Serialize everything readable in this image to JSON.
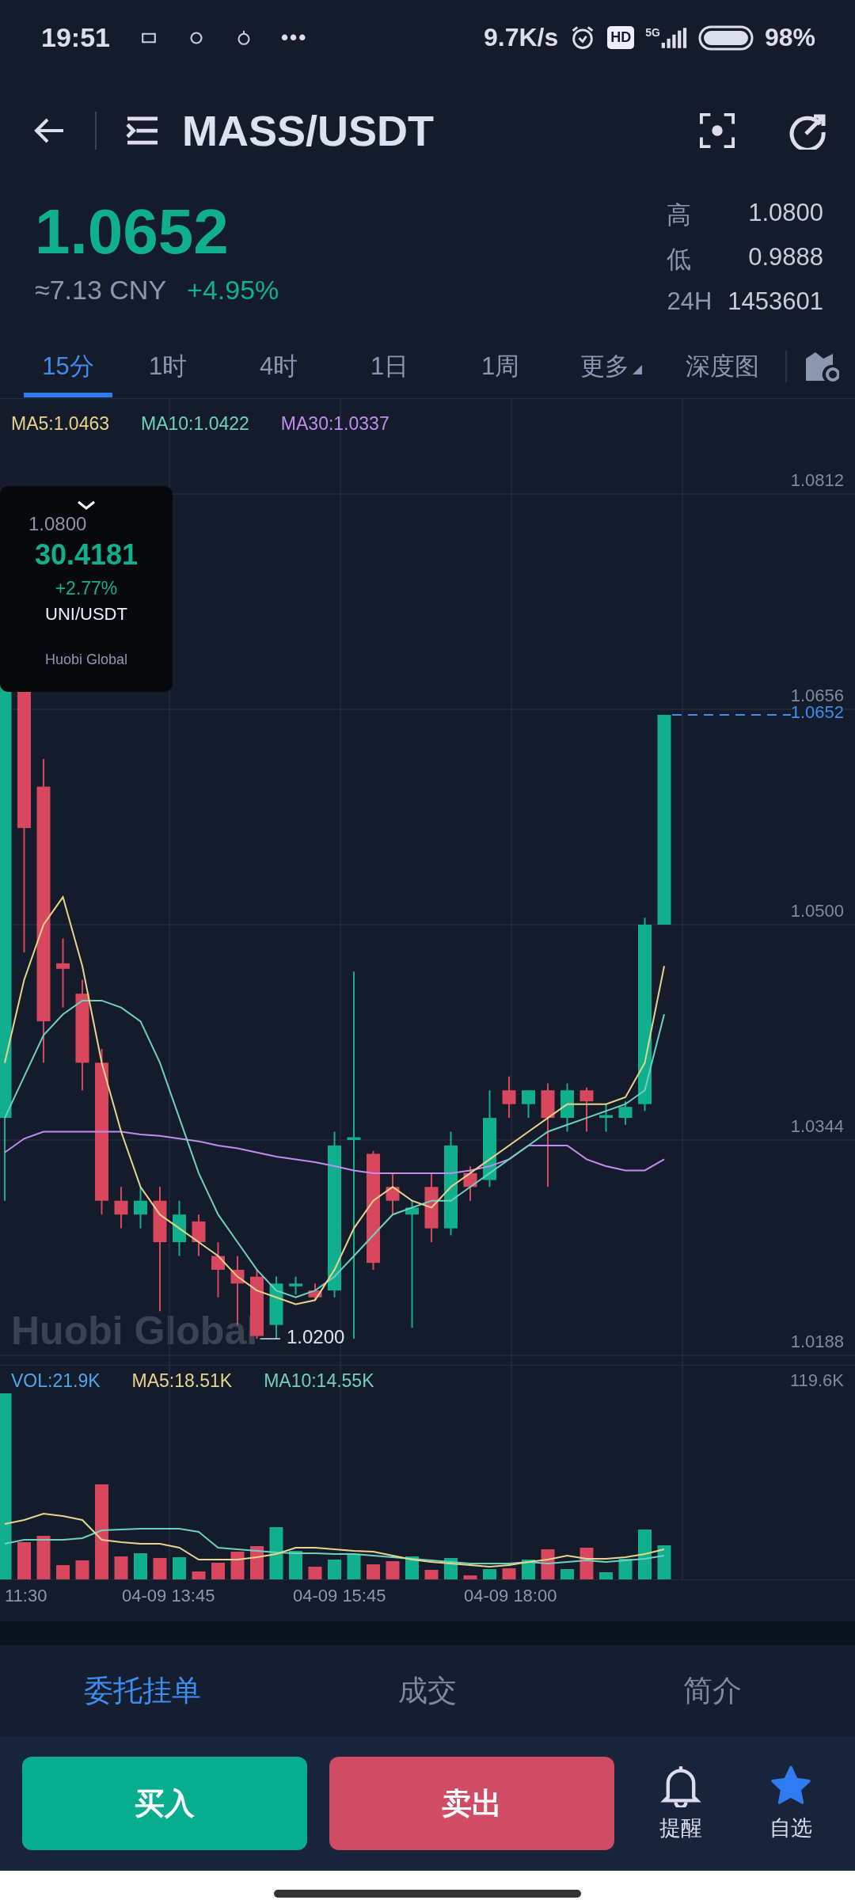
{
  "status_bar": {
    "time": "19:51",
    "more": "•••",
    "speed": "9.7K/s",
    "hd": "HD",
    "network": "5G",
    "battery": "98%"
  },
  "header": {
    "pair": "MASS/USDT"
  },
  "price": {
    "last": "1.0652",
    "cny": "≈7.13 CNY",
    "change": "+4.95%",
    "stats": [
      {
        "label": "高",
        "value": "1.0800"
      },
      {
        "label": "低",
        "value": "0.9888"
      },
      {
        "label": "24H",
        "value": "1453601"
      }
    ]
  },
  "intervals": [
    {
      "label": "15分",
      "selected": true,
      "kind": "plain"
    },
    {
      "label": "1时",
      "selected": false,
      "kind": "plain"
    },
    {
      "label": "4时",
      "selected": false,
      "kind": "plain"
    },
    {
      "label": "1日",
      "selected": false,
      "kind": "plain"
    },
    {
      "label": "1周",
      "selected": false,
      "kind": "plain"
    },
    {
      "label": "更多",
      "selected": false,
      "kind": "dropdown"
    },
    {
      "label": "深度图",
      "selected": false,
      "kind": "plain"
    }
  ],
  "chart": {
    "ma_legend": [
      {
        "text": "MA5:1.0463",
        "color": "#e8d48a"
      },
      {
        "text": "MA10:1.0422",
        "color": "#6fd0c0"
      },
      {
        "text": "MA30:1.0337",
        "color": "#c38cf0"
      }
    ],
    "y_labels": [
      "1.0812",
      "1.0656",
      "1.0500",
      "1.0344",
      "1.0188"
    ],
    "high_marker": "1.0800",
    "low_marker": "1.0200",
    "last_marker": "1.0652",
    "watermark": "Huobi Global"
  },
  "ticker_card": {
    "price": "30.4181",
    "change": "+2.77%",
    "pair": "UNI/USDT",
    "brand": "Huobi Global"
  },
  "volume": {
    "legend": [
      {
        "text": "VOL:21.9K",
        "color": "#4aa8f0"
      },
      {
        "text": "MA5:18.51K",
        "color": "#e8d48a"
      },
      {
        "text": "MA10:14.55K",
        "color": "#6fd0c0"
      }
    ],
    "max_label": "119.6K"
  },
  "time_labels": [
    "11:30",
    "04-09 13:45",
    "04-09 15:45",
    "04-09 18:00"
  ],
  "bottom_tabs": [
    {
      "label": "委托挂单",
      "selected": true
    },
    {
      "label": "成交",
      "selected": false
    },
    {
      "label": "简介",
      "selected": false
    }
  ],
  "actions": {
    "buy": "买入",
    "sell": "卖出",
    "alert": "提醒",
    "favorite": "自选",
    "favorited": true
  }
}
